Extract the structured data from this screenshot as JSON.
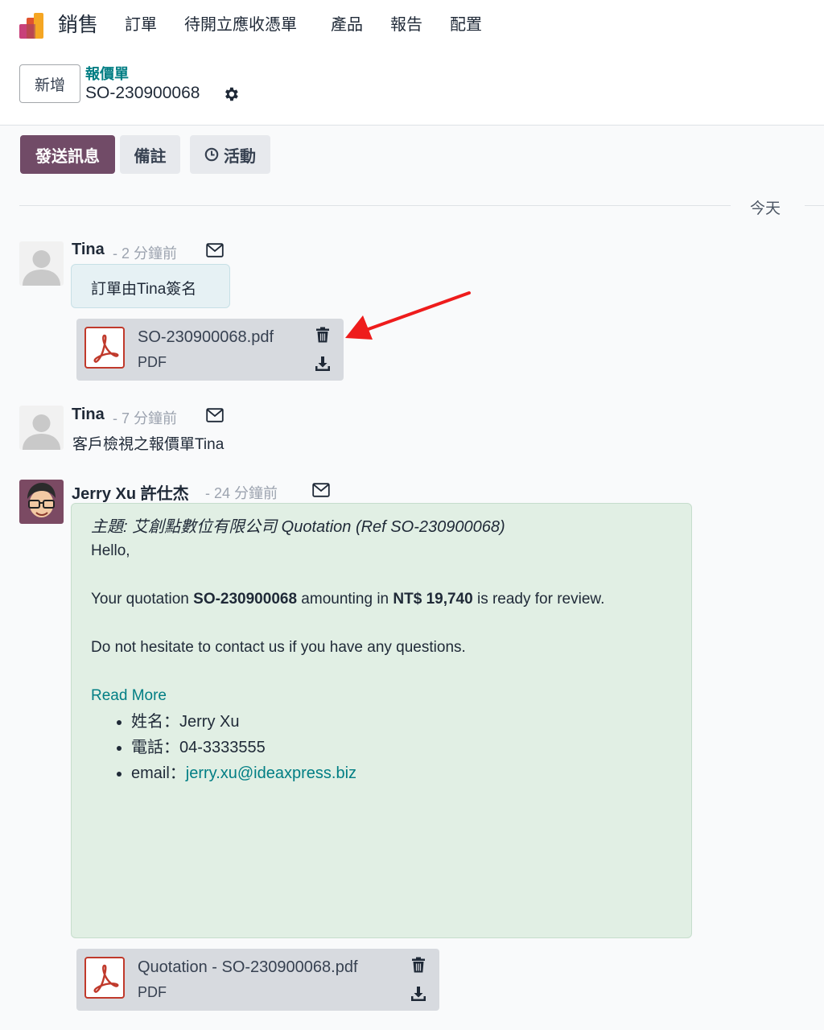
{
  "nav": {
    "app_name": "銷售",
    "menu": [
      "訂單",
      "待開立應收憑單",
      "產品",
      "報告",
      "配置"
    ]
  },
  "control_panel": {
    "new_label": "新增",
    "breadcrumb_parent": "報價單",
    "record_name": "SO-230900068"
  },
  "chatter": {
    "send_message_label": "發送訊息",
    "log_note_label": "備註",
    "activity_label": "活動",
    "date_separator": "今天",
    "messages": [
      {
        "author": "Tina",
        "time": "- 2 分鐘前",
        "body": "訂單由Tina簽名",
        "attachment": {
          "name": "SO-230900068.pdf",
          "type": "PDF"
        }
      },
      {
        "author": "Tina",
        "time": "- 7 分鐘前",
        "body": "客戶檢視之報價單Tina"
      },
      {
        "author": "Jerry Xu 許仕杰",
        "time": "- 24 分鐘前",
        "subject": "主題: 艾創點數位有限公司 Quotation (Ref SO-230900068)",
        "greeting": "Hello,",
        "line_prefix": "Your quotation ",
        "quote_ref": "SO-230900068",
        "line_mid": " amounting in ",
        "amount": "NT$ 19,740",
        "line_suffix": " is ready for review.",
        "contact_line": "Do not hesitate to contact us if you have any questions.",
        "read_more": "Read More",
        "contact_name": "姓名：Jerry Xu",
        "contact_phone": "電話：04-3333555",
        "contact_email_label": "email：",
        "contact_email": "jerry.xu@ideaxpress.biz",
        "attachment": {
          "name": "Quotation - SO-230900068.pdf",
          "type": "PDF"
        }
      }
    ]
  },
  "colors": {
    "brand": "#714b67",
    "link": "#017e84",
    "annotation_arrow": "#ee1c1c"
  }
}
